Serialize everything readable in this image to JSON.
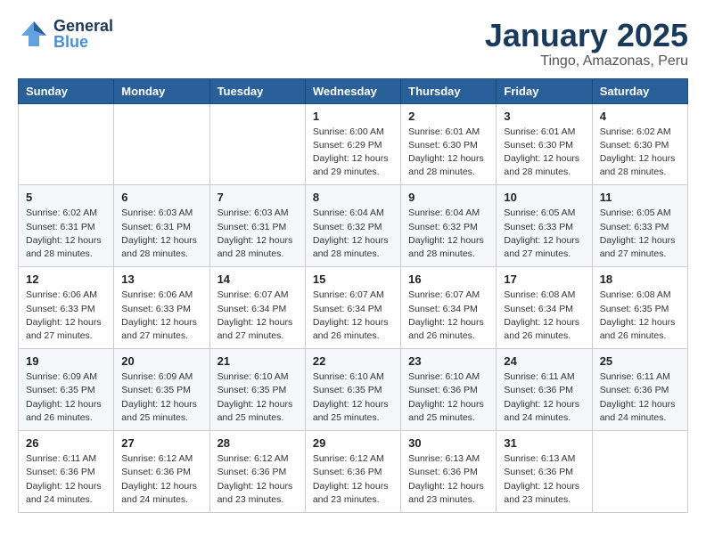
{
  "header": {
    "logo_general": "General",
    "logo_blue": "Blue",
    "title": "January 2025",
    "subtitle": "Tingo, Amazonas, Peru"
  },
  "weekdays": [
    "Sunday",
    "Monday",
    "Tuesday",
    "Wednesday",
    "Thursday",
    "Friday",
    "Saturday"
  ],
  "weeks": [
    [
      {
        "day": "",
        "info": ""
      },
      {
        "day": "",
        "info": ""
      },
      {
        "day": "",
        "info": ""
      },
      {
        "day": "1",
        "info": "Sunrise: 6:00 AM\nSunset: 6:29 PM\nDaylight: 12 hours\nand 29 minutes."
      },
      {
        "day": "2",
        "info": "Sunrise: 6:01 AM\nSunset: 6:30 PM\nDaylight: 12 hours\nand 28 minutes."
      },
      {
        "day": "3",
        "info": "Sunrise: 6:01 AM\nSunset: 6:30 PM\nDaylight: 12 hours\nand 28 minutes."
      },
      {
        "day": "4",
        "info": "Sunrise: 6:02 AM\nSunset: 6:30 PM\nDaylight: 12 hours\nand 28 minutes."
      }
    ],
    [
      {
        "day": "5",
        "info": "Sunrise: 6:02 AM\nSunset: 6:31 PM\nDaylight: 12 hours\nand 28 minutes."
      },
      {
        "day": "6",
        "info": "Sunrise: 6:03 AM\nSunset: 6:31 PM\nDaylight: 12 hours\nand 28 minutes."
      },
      {
        "day": "7",
        "info": "Sunrise: 6:03 AM\nSunset: 6:31 PM\nDaylight: 12 hours\nand 28 minutes."
      },
      {
        "day": "8",
        "info": "Sunrise: 6:04 AM\nSunset: 6:32 PM\nDaylight: 12 hours\nand 28 minutes."
      },
      {
        "day": "9",
        "info": "Sunrise: 6:04 AM\nSunset: 6:32 PM\nDaylight: 12 hours\nand 28 minutes."
      },
      {
        "day": "10",
        "info": "Sunrise: 6:05 AM\nSunset: 6:33 PM\nDaylight: 12 hours\nand 27 minutes."
      },
      {
        "day": "11",
        "info": "Sunrise: 6:05 AM\nSunset: 6:33 PM\nDaylight: 12 hours\nand 27 minutes."
      }
    ],
    [
      {
        "day": "12",
        "info": "Sunrise: 6:06 AM\nSunset: 6:33 PM\nDaylight: 12 hours\nand 27 minutes."
      },
      {
        "day": "13",
        "info": "Sunrise: 6:06 AM\nSunset: 6:33 PM\nDaylight: 12 hours\nand 27 minutes."
      },
      {
        "day": "14",
        "info": "Sunrise: 6:07 AM\nSunset: 6:34 PM\nDaylight: 12 hours\nand 27 minutes."
      },
      {
        "day": "15",
        "info": "Sunrise: 6:07 AM\nSunset: 6:34 PM\nDaylight: 12 hours\nand 26 minutes."
      },
      {
        "day": "16",
        "info": "Sunrise: 6:07 AM\nSunset: 6:34 PM\nDaylight: 12 hours\nand 26 minutes."
      },
      {
        "day": "17",
        "info": "Sunrise: 6:08 AM\nSunset: 6:34 PM\nDaylight: 12 hours\nand 26 minutes."
      },
      {
        "day": "18",
        "info": "Sunrise: 6:08 AM\nSunset: 6:35 PM\nDaylight: 12 hours\nand 26 minutes."
      }
    ],
    [
      {
        "day": "19",
        "info": "Sunrise: 6:09 AM\nSunset: 6:35 PM\nDaylight: 12 hours\nand 26 minutes."
      },
      {
        "day": "20",
        "info": "Sunrise: 6:09 AM\nSunset: 6:35 PM\nDaylight: 12 hours\nand 25 minutes."
      },
      {
        "day": "21",
        "info": "Sunrise: 6:10 AM\nSunset: 6:35 PM\nDaylight: 12 hours\nand 25 minutes."
      },
      {
        "day": "22",
        "info": "Sunrise: 6:10 AM\nSunset: 6:35 PM\nDaylight: 12 hours\nand 25 minutes."
      },
      {
        "day": "23",
        "info": "Sunrise: 6:10 AM\nSunset: 6:36 PM\nDaylight: 12 hours\nand 25 minutes."
      },
      {
        "day": "24",
        "info": "Sunrise: 6:11 AM\nSunset: 6:36 PM\nDaylight: 12 hours\nand 24 minutes."
      },
      {
        "day": "25",
        "info": "Sunrise: 6:11 AM\nSunset: 6:36 PM\nDaylight: 12 hours\nand 24 minutes."
      }
    ],
    [
      {
        "day": "26",
        "info": "Sunrise: 6:11 AM\nSunset: 6:36 PM\nDaylight: 12 hours\nand 24 minutes."
      },
      {
        "day": "27",
        "info": "Sunrise: 6:12 AM\nSunset: 6:36 PM\nDaylight: 12 hours\nand 24 minutes."
      },
      {
        "day": "28",
        "info": "Sunrise: 6:12 AM\nSunset: 6:36 PM\nDaylight: 12 hours\nand 23 minutes."
      },
      {
        "day": "29",
        "info": "Sunrise: 6:12 AM\nSunset: 6:36 PM\nDaylight: 12 hours\nand 23 minutes."
      },
      {
        "day": "30",
        "info": "Sunrise: 6:13 AM\nSunset: 6:36 PM\nDaylight: 12 hours\nand 23 minutes."
      },
      {
        "day": "31",
        "info": "Sunrise: 6:13 AM\nSunset: 6:36 PM\nDaylight: 12 hours\nand 23 minutes."
      },
      {
        "day": "",
        "info": ""
      }
    ]
  ]
}
